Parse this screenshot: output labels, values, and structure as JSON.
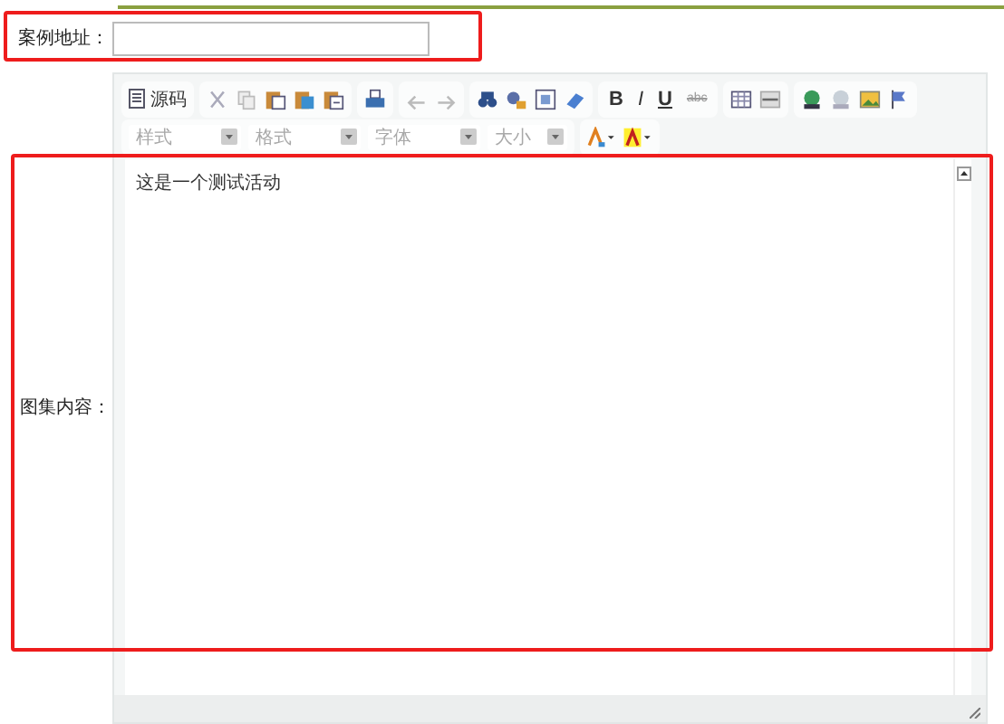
{
  "address_field": {
    "label": "案例地址："
  },
  "editor": {
    "label": "图集内容：",
    "source_button": "源码",
    "format_buttons": [
      "B",
      "I",
      "U",
      "abc"
    ],
    "dropdowns": [
      {
        "label": "样式",
        "disabled": true
      },
      {
        "label": "格式",
        "disabled": true
      },
      {
        "label": "字体",
        "disabled": true
      },
      {
        "label": "大小",
        "disabled": true
      }
    ],
    "content": "这是一个测试活动"
  }
}
